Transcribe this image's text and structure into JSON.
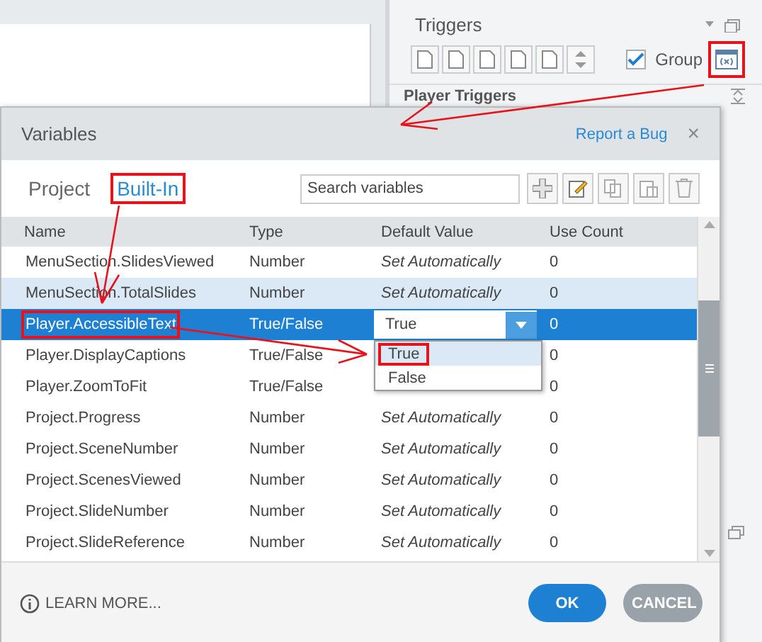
{
  "triggers_panel": {
    "title": "Triggers",
    "group_checkbox": {
      "label": "Group",
      "checked": true
    },
    "variables_button": {
      "annotated": true
    },
    "section": "Player Triggers"
  },
  "dialog": {
    "title": "Variables",
    "report_link": "Report a Bug",
    "close": "×",
    "tabs": [
      {
        "label": "Project",
        "selected": false,
        "annotated": false
      },
      {
        "label": "Built-In",
        "selected": true,
        "annotated": true
      }
    ],
    "search": {
      "placeholder": "Search variables"
    },
    "columns": [
      "Name",
      "Type",
      "Default Value",
      "Use Count"
    ],
    "rows": [
      {
        "name": "MenuSection.SlidesViewed",
        "type": "Number",
        "kind": "auto",
        "default_value": "Set Automatically",
        "use_count": "0",
        "selected": false,
        "hovered": false,
        "annotated": false
      },
      {
        "name": "MenuSection.TotalSlides",
        "type": "Number",
        "kind": "auto",
        "default_value": "Set Automatically",
        "use_count": "0",
        "selected": false,
        "hovered": true,
        "annotated": false
      },
      {
        "name": "Player.AccessibleText",
        "type": "True/False",
        "kind": "dropdown",
        "default_value": "True",
        "use_count": "0",
        "selected": true,
        "hovered": false,
        "annotated": true,
        "options": [
          {
            "label": "True",
            "selected": true,
            "annotated": true
          },
          {
            "label": "False",
            "selected": false,
            "annotated": false
          }
        ]
      },
      {
        "name": "Player.DisplayCaptions",
        "type": "True/False",
        "kind": "covered",
        "use_count": "0",
        "selected": false,
        "hovered": false,
        "annotated": false
      },
      {
        "name": "Player.ZoomToFit",
        "type": "True/False",
        "kind": "covered",
        "use_count": "0",
        "selected": false,
        "hovered": false,
        "annotated": false
      },
      {
        "name": "Project.Progress",
        "type": "Number",
        "kind": "auto",
        "default_value": "Set Automatically",
        "use_count": "0",
        "selected": false,
        "hovered": false,
        "annotated": false
      },
      {
        "name": "Project.SceneNumber",
        "type": "Number",
        "kind": "auto",
        "default_value": "Set Automatically",
        "use_count": "0",
        "selected": false,
        "hovered": false,
        "annotated": false
      },
      {
        "name": "Project.ScenesViewed",
        "type": "Number",
        "kind": "auto",
        "default_value": "Set Automatically",
        "use_count": "0",
        "selected": false,
        "hovered": false,
        "annotated": false
      },
      {
        "name": "Project.SlideNumber",
        "type": "Number",
        "kind": "auto",
        "default_value": "Set Automatically",
        "use_count": "0",
        "selected": false,
        "hovered": false,
        "annotated": false
      },
      {
        "name": "Project.SlideReference",
        "type": "Number",
        "kind": "auto",
        "default_value": "Set Automatically",
        "use_count": "0",
        "selected": false,
        "hovered": false,
        "annotated": false
      }
    ],
    "learn_more": "LEARN MORE...",
    "buttons": [
      {
        "label": "OK",
        "kind": "primary"
      },
      {
        "label": "CANCEL",
        "kind": "secondary"
      }
    ]
  }
}
